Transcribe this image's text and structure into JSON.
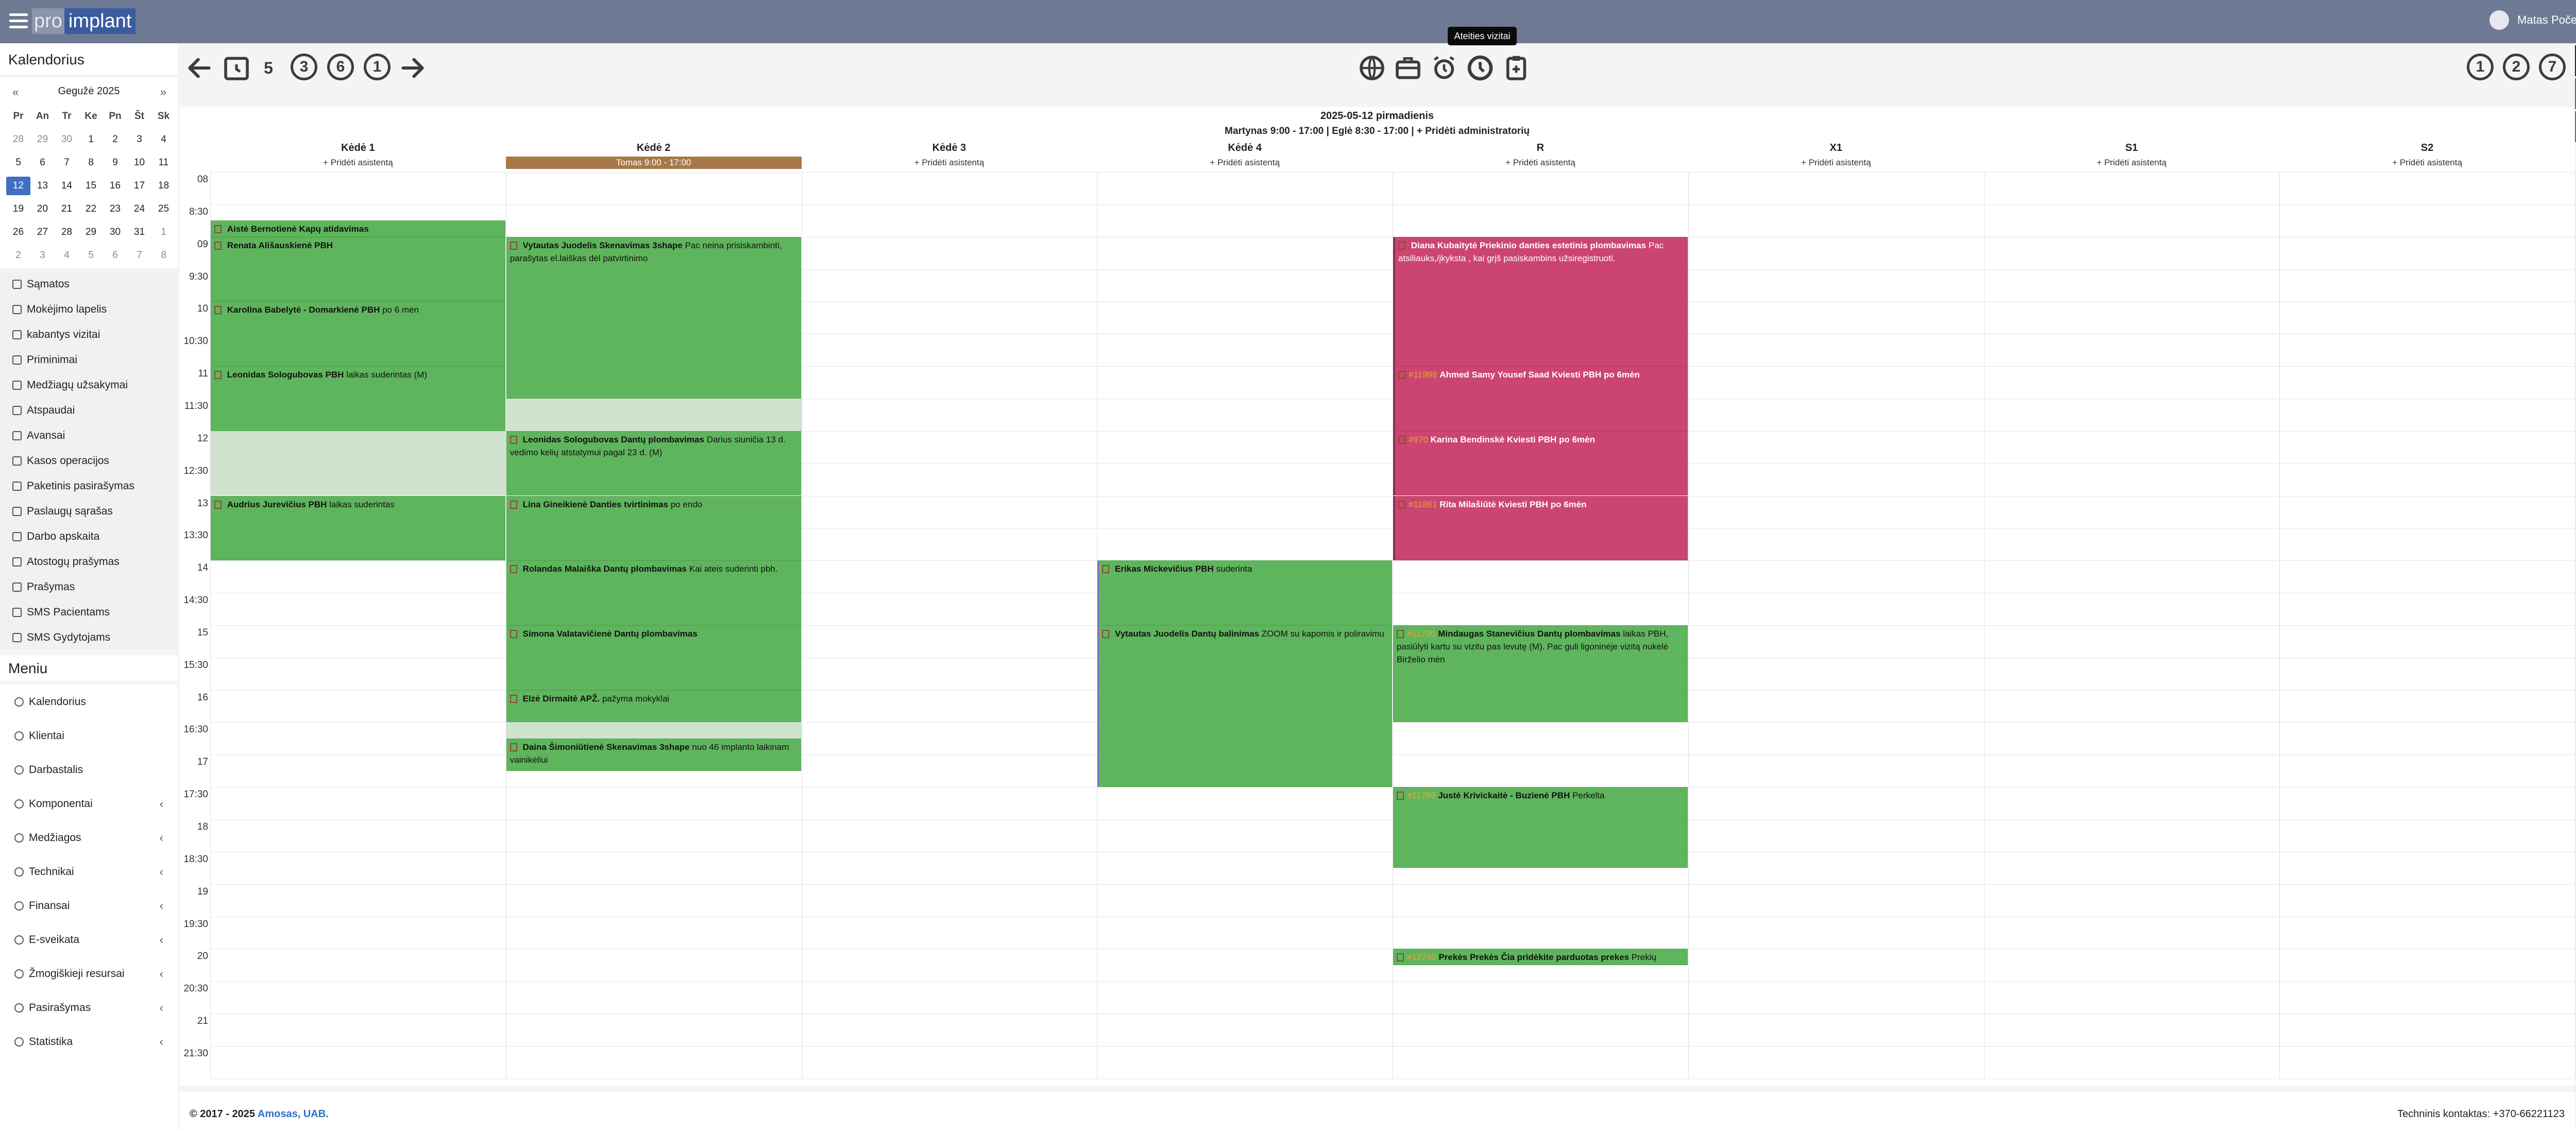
{
  "header": {
    "logo_pre": "pro",
    "logo_main": "implant",
    "user_name": "Matas Počebutas"
  },
  "left_title": "Kalendorius",
  "tooltip": "Ateities vizitai",
  "toolbar": {
    "page_num": "5",
    "icon3": "3",
    "icon6": "6",
    "icon1": "1",
    "right1": "1",
    "right2": "2",
    "right7": "7"
  },
  "mini_calendar": {
    "prev": "«",
    "next": "»",
    "month": "Gegužė 2025",
    "weekdays": [
      "Pr",
      "An",
      "Tr",
      "Ke",
      "Pn",
      "Št",
      "Sk"
    ],
    "weeks": [
      [
        "28",
        "29",
        "30",
        "1",
        "2",
        "3",
        "4"
      ],
      [
        "5",
        "6",
        "7",
        "8",
        "9",
        "10",
        "11"
      ],
      [
        "12",
        "13",
        "14",
        "15",
        "16",
        "17",
        "18"
      ],
      [
        "19",
        "20",
        "21",
        "22",
        "23",
        "24",
        "25"
      ],
      [
        "26",
        "27",
        "28",
        "29",
        "30",
        "31",
        "1"
      ],
      [
        "2",
        "3",
        "4",
        "5",
        "6",
        "7",
        "8"
      ]
    ]
  },
  "side_menu": [
    "Sąmatos",
    "Mokėjimo lapelis",
    "kabantys vizitai",
    "Priminimai",
    "Medžiagų užsakymai",
    "Atspaudai",
    "Avansai",
    "Kasos operacijos",
    "Paketinis pasirašymas",
    "Paslaugų sąrašas",
    "Darbo apskaita",
    "Atostogų prašymas",
    "Prašymas",
    "SMS Pacientams",
    "SMS Gydytojams"
  ],
  "meniu_title": "Meniu",
  "main_menu": [
    {
      "label": "Kalendorius",
      "chev": ""
    },
    {
      "label": "Klientai",
      "chev": ""
    },
    {
      "label": "Darbastalis",
      "chev": ""
    },
    {
      "label": "Komponentai",
      "chev": "‹"
    },
    {
      "label": "Medžiagos",
      "chev": "‹"
    },
    {
      "label": "Technikai",
      "chev": "‹"
    },
    {
      "label": "Finansai",
      "chev": "‹"
    },
    {
      "label": "E-sveikata",
      "chev": "‹"
    },
    {
      "label": "Žmogiškieji resursai",
      "chev": "‹"
    },
    {
      "label": "Pasirašymas",
      "chev": "‹"
    },
    {
      "label": "Statistika",
      "chev": "‹"
    }
  ],
  "calendar": {
    "date_title": "2025-05-12 pirmadienis",
    "staff_line": "Martynas 9:00 - 17:00 | Eglė 8:30 - 17:00 | + Pridėti administratorių",
    "columns": [
      {
        "name": "Kėdė 1",
        "assistant": "+ Pridėti asistentą"
      },
      {
        "name": "Kėdė 2",
        "assistant": "Tomas 9:00 - 17:00"
      },
      {
        "name": "Kėdė 3",
        "assistant": "+ Pridėti asistentą"
      },
      {
        "name": "Kėdė 4",
        "assistant": "+ Pridėti asistentą"
      },
      {
        "name": "R",
        "assistant": "+ Pridėti asistentą"
      },
      {
        "name": "X1",
        "assistant": "+ Pridėti asistentą"
      },
      {
        "name": "S1",
        "assistant": "+ Pridėti asistentą"
      },
      {
        "name": "S2",
        "assistant": "+ Pridėti asistentą"
      }
    ],
    "times": [
      "08",
      "8:30",
      "09",
      "9:30",
      "10",
      "10:30",
      "11",
      "11:30",
      "12",
      "12:30",
      "13",
      "13:30",
      "14",
      "14:30",
      "15",
      "15:30",
      "16",
      "16:30",
      "17",
      "17:30",
      "18",
      "18:30",
      "19",
      "19:30",
      "20",
      "20:30",
      "21",
      "21:30"
    ],
    "events": [
      {
        "col": 0,
        "start": "08:45",
        "end": "09:00",
        "color": "green",
        "num": "",
        "title": "Aistė Bernotienė Kapų atidavimas",
        "note": ""
      },
      {
        "col": 0,
        "start": "09:00",
        "end": "10:00",
        "color": "green",
        "num": "",
        "title": "Renata Ališauskienė PBH",
        "note": ""
      },
      {
        "col": 0,
        "start": "10:00",
        "end": "11:00",
        "color": "green",
        "num": "",
        "title": "Karolina Babelytė - Domarkienė PBH",
        "note": "po 6 mėn"
      },
      {
        "col": 0,
        "start": "11:00",
        "end": "12:00",
        "color": "green",
        "num": "",
        "title": "Leonidas Sologubovas PBH",
        "note": "laikas suderintas (M)"
      },
      {
        "col": 0,
        "start": "13:00",
        "end": "14:00",
        "color": "green",
        "num": "",
        "title": "Audrius Jurevičius PBH",
        "note": "laikas suderintas"
      },
      {
        "col": 1,
        "start": "09:00",
        "end": "11:30",
        "color": "green",
        "num": "",
        "title": "Vytautas Juodelis Skenavimas 3shape",
        "note": "Pac neina prisiskambinti, parašytas el.laiškas dėl patvirtinimo"
      },
      {
        "col": 1,
        "start": "12:00",
        "end": "13:00",
        "color": "green",
        "num": "",
        "title": "Leonidas Sologubovas Dantų plombavimas",
        "note": "Darius siuničia 13 d. vedimo kelių atstatymui pagal 23 d. (M)"
      },
      {
        "col": 1,
        "start": "13:00",
        "end": "14:00",
        "color": "green",
        "num": "",
        "title": "Lina Gineikienė Danties tvirtinimas",
        "note": "po endo"
      },
      {
        "col": 1,
        "start": "14:00",
        "end": "15:00",
        "color": "green",
        "num": "",
        "title": "Rolandas Malaiška Dantų plombavimas",
        "note": "Kai ateis suderinti pbh."
      },
      {
        "col": 1,
        "start": "15:00",
        "end": "16:00",
        "color": "green",
        "num": "",
        "title": "Simona Valatavičienė Dantų plombavimas",
        "note": ""
      },
      {
        "col": 1,
        "start": "16:00",
        "end": "16:30",
        "color": "green",
        "num": "",
        "title": "Elzė Dirmaitė APŽ.",
        "note": "pažyma mokyklai"
      },
      {
        "col": 1,
        "start": "16:45",
        "end": "17:15",
        "color": "green",
        "num": "",
        "title": "Daina Šimoniūtienė Skenavimas 3shape",
        "note": "nuo 46 implanto laikinam vainikėliui"
      },
      {
        "col": 3,
        "start": "14:00",
        "end": "15:00",
        "color": "green",
        "num": "",
        "title": "Erikas Mickevičius PBH",
        "note": "suderinta",
        "blue": true
      },
      {
        "col": 3,
        "start": "15:00",
        "end": "17:30",
        "color": "green",
        "num": "",
        "title": "Vytautas Juodelis Dantų balinimas",
        "note": "ZOOM su kapomis ir poliravimu",
        "blue": true
      },
      {
        "col": 4,
        "start": "09:00",
        "end": "11:00",
        "color": "pink",
        "num": "",
        "title": "Diana Kubaitytė Priekinio danties estetinis plombavimas",
        "note": "Pac atsiliauks,/įkyksta , kai grįš pasiskambins užsiregistruoti."
      },
      {
        "col": 4,
        "start": "11:00",
        "end": "12:00",
        "color": "pink",
        "num": "#11998",
        "title": "Ahmed Samy Yousef Saad Kviesti PBH po 6mėn",
        "note": ""
      },
      {
        "col": 4,
        "start": "12:00",
        "end": "13:00",
        "color": "pink",
        "num": "#970",
        "title": "Karina Bendinskė Kviesti PBH po 6mėn",
        "note": ""
      },
      {
        "col": 4,
        "start": "13:00",
        "end": "14:00",
        "color": "pink",
        "num": "#11861",
        "title": "Rita Milašiūtė Kviesti PBH po 6mėn",
        "note": ""
      },
      {
        "col": 4,
        "start": "15:00",
        "end": "16:30",
        "color": "green",
        "num": "#11720",
        "title": "Mindaugas Stanevičius Dantų plombavimas",
        "note": "laikas PBH, pasiūlyti kartu su vizitu pas levutę (M). Pac guli ligoninėje vizitą nukėlė Birželio mėn"
      },
      {
        "col": 4,
        "start": "17:30",
        "end": "18:45",
        "color": "green",
        "num": "#11789",
        "title": "Justė Krivickaitė - Buzienė PBH",
        "note": "Perkelta"
      },
      {
        "col": 4,
        "start": "20:00",
        "end": "20:15",
        "color": "green",
        "num": "#12740",
        "title": "Prekės Prekės Čia pridėkite parduotas prekes",
        "note": "Prekių"
      }
    ]
  },
  "footer": {
    "copyright": "© 2017 - 2025 ",
    "company": "Amosas, UAB.",
    "contact": "Techninis kontaktas: +370-66221123"
  }
}
